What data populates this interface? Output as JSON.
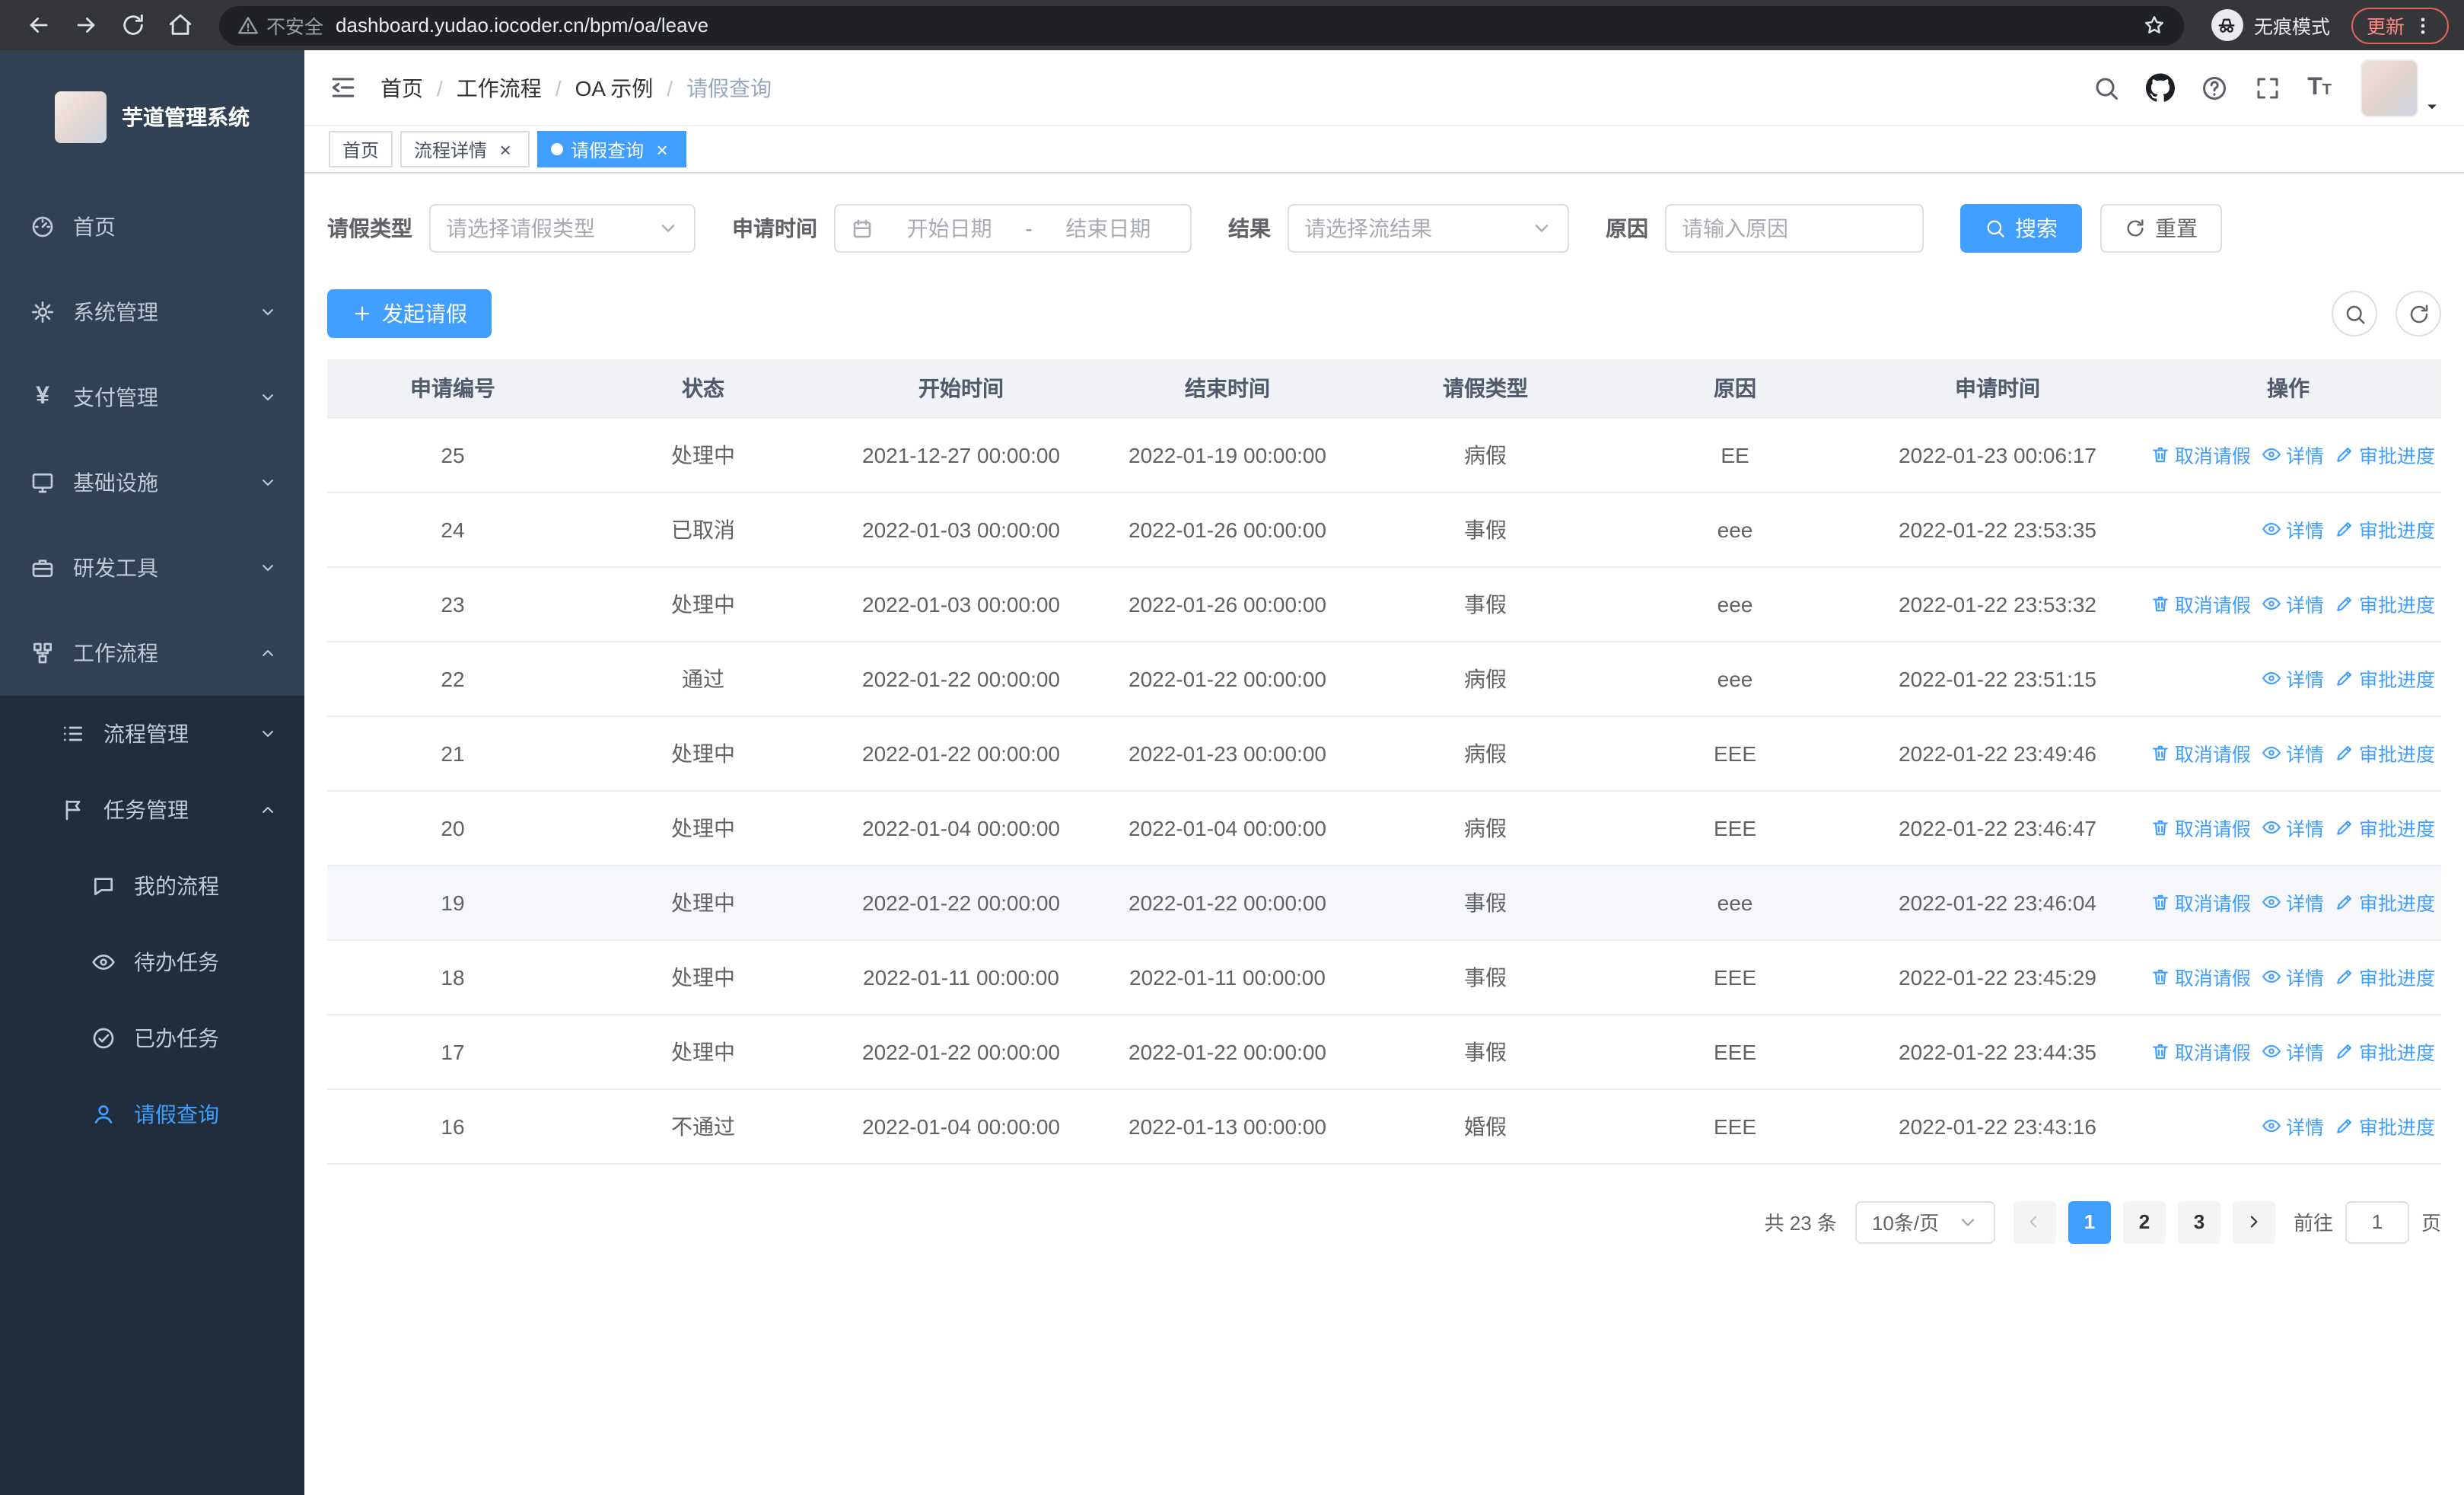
{
  "browser": {
    "security_label": "不安全",
    "url": "dashboard.yudao.iocoder.cn/bpm/oa/leave",
    "incognito_label": "无痕模式",
    "update_label": "更新"
  },
  "sidebar": {
    "logo_title": "芋道管理系统",
    "items": [
      {
        "key": "home",
        "label": "首页",
        "icon": "dashboard-icon",
        "level": 1
      },
      {
        "key": "system-management",
        "label": "系统管理",
        "icon": "gear-icon",
        "level": 1,
        "arrow": "down"
      },
      {
        "key": "payment-management",
        "label": "支付管理",
        "icon": "yen-icon",
        "level": 1,
        "arrow": "down"
      },
      {
        "key": "infrastructure",
        "label": "基础设施",
        "icon": "monitor-icon",
        "level": 1,
        "arrow": "down"
      },
      {
        "key": "dev-tools",
        "label": "研发工具",
        "icon": "briefcase-icon",
        "level": 1,
        "arrow": "down"
      },
      {
        "key": "workflow",
        "label": "工作流程",
        "icon": "workflow-icon",
        "level": 1,
        "arrow": "up"
      },
      {
        "key": "process-management",
        "label": "流程管理",
        "icon": "list-icon",
        "level": 2,
        "arrow": "down"
      },
      {
        "key": "task-management",
        "label": "任务管理",
        "icon": "flag-icon",
        "level": 2,
        "arrow": "up"
      },
      {
        "key": "my-process",
        "label": "我的流程",
        "icon": "chat-icon",
        "level": 3
      },
      {
        "key": "todo-tasks",
        "label": "待办任务",
        "icon": "eye-icon",
        "level": 3
      },
      {
        "key": "done-tasks",
        "label": "已办任务",
        "icon": "check-circle-icon",
        "level": 3
      },
      {
        "key": "leave-query",
        "label": "请假查询",
        "icon": "user-icon",
        "level": 3,
        "active": true
      }
    ]
  },
  "header": {
    "breadcrumb": [
      "首页",
      "工作流程",
      "OA 示例",
      "请假查询"
    ],
    "breadcrumb_separator": "/",
    "font_icon": "T"
  },
  "tabs": [
    {
      "key": "home",
      "label": "首页",
      "closable": false,
      "active": false
    },
    {
      "key": "process-detail",
      "label": "流程详情",
      "closable": true,
      "active": false
    },
    {
      "key": "leave-query",
      "label": "请假查询",
      "closable": true,
      "active": true
    }
  ],
  "filters": {
    "leave_type_label": "请假类型",
    "leave_type_placeholder": "请选择请假类型",
    "apply_time_label": "申请时间",
    "start_date_placeholder": "开始日期",
    "range_separator": "-",
    "end_date_placeholder": "结束日期",
    "result_label": "结果",
    "result_placeholder": "请选择流结果",
    "reason_label": "原因",
    "reason_placeholder": "请输入原因",
    "search_button": "搜索",
    "reset_button": "重置"
  },
  "toolbar": {
    "create_button": "发起请假"
  },
  "table": {
    "columns": [
      "申请编号",
      "状态",
      "开始时间",
      "结束时间",
      "请假类型",
      "原因",
      "申请时间",
      "操作"
    ],
    "action_labels": {
      "cancel": "取消请假",
      "detail": "详情",
      "progress": "审批进度"
    },
    "rows": [
      {
        "id": "25",
        "status": "处理中",
        "start": "2021-12-27 00:00:00",
        "end": "2022-01-19 00:00:00",
        "type": "病假",
        "reason": "EE",
        "applied": "2022-01-23 00:06:17",
        "cancelable": true
      },
      {
        "id": "24",
        "status": "已取消",
        "start": "2022-01-03 00:00:00",
        "end": "2022-01-26 00:00:00",
        "type": "事假",
        "reason": "eee",
        "applied": "2022-01-22 23:53:35",
        "cancelable": false
      },
      {
        "id": "23",
        "status": "处理中",
        "start": "2022-01-03 00:00:00",
        "end": "2022-01-26 00:00:00",
        "type": "事假",
        "reason": "eee",
        "applied": "2022-01-22 23:53:32",
        "cancelable": true
      },
      {
        "id": "22",
        "status": "通过",
        "start": "2022-01-22 00:00:00",
        "end": "2022-01-22 00:00:00",
        "type": "病假",
        "reason": "eee",
        "applied": "2022-01-22 23:51:15",
        "cancelable": false
      },
      {
        "id": "21",
        "status": "处理中",
        "start": "2022-01-22 00:00:00",
        "end": "2022-01-23 00:00:00",
        "type": "病假",
        "reason": "EEE",
        "applied": "2022-01-22 23:49:46",
        "cancelable": true
      },
      {
        "id": "20",
        "status": "处理中",
        "start": "2022-01-04 00:00:00",
        "end": "2022-01-04 00:00:00",
        "type": "病假",
        "reason": "EEE",
        "applied": "2022-01-22 23:46:47",
        "cancelable": true
      },
      {
        "id": "19",
        "status": "处理中",
        "start": "2022-01-22 00:00:00",
        "end": "2022-01-22 00:00:00",
        "type": "事假",
        "reason": "eee",
        "applied": "2022-01-22 23:46:04",
        "cancelable": true,
        "hovered": true
      },
      {
        "id": "18",
        "status": "处理中",
        "start": "2022-01-11 00:00:00",
        "end": "2022-01-11 00:00:00",
        "type": "事假",
        "reason": "EEE",
        "applied": "2022-01-22 23:45:29",
        "cancelable": true
      },
      {
        "id": "17",
        "status": "处理中",
        "start": "2022-01-22 00:00:00",
        "end": "2022-01-22 00:00:00",
        "type": "事假",
        "reason": "EEE",
        "applied": "2022-01-22 23:44:35",
        "cancelable": true
      },
      {
        "id": "16",
        "status": "不通过",
        "start": "2022-01-04 00:00:00",
        "end": "2022-01-13 00:00:00",
        "type": "婚假",
        "reason": "EEE",
        "applied": "2022-01-22 23:43:16",
        "cancelable": false
      }
    ]
  },
  "pagination": {
    "total_label": "共 23 条",
    "page_size_label": "10条/页",
    "pages": [
      "1",
      "2",
      "3"
    ],
    "active_page": "1",
    "goto_label": "前往",
    "goto_value": "1",
    "page_label": "页"
  }
}
